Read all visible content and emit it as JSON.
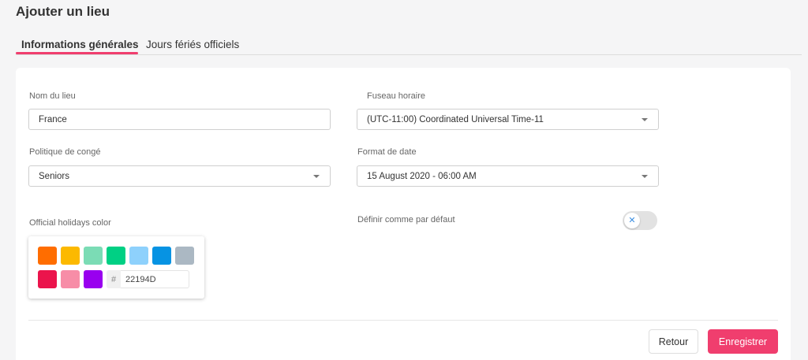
{
  "page": {
    "title": "Ajouter un lieu"
  },
  "tabs": [
    {
      "label": "Informations générales",
      "active": true
    },
    {
      "label": "Jours fériés officiels",
      "active": false
    }
  ],
  "form": {
    "location_name": {
      "label": "Nom du lieu",
      "value": "France"
    },
    "timezone": {
      "label": "Fuseau horaire",
      "value": "(UTC-11:00) Coordinated Universal Time-11"
    },
    "leave_policy": {
      "label": "Politique de congé",
      "value": "Seniors"
    },
    "date_format": {
      "label": "Format de date",
      "value": "15 August 2020 - 06:00 AM"
    },
    "holiday_color": {
      "label": "Official holidays color",
      "swatches": [
        "#ff6d00",
        "#fcb900",
        "#7bdcb5",
        "#00d084",
        "#8ed1fc",
        "#0693e3",
        "#abb8c3",
        "#eb144c",
        "#f78da7",
        "#9900ef"
      ],
      "hash": "#",
      "hex_value": "22194D"
    },
    "default": {
      "label": "Définir comme par défaut",
      "enabled": false,
      "knob_symbol": "✕"
    }
  },
  "actions": {
    "back_label": "Retour",
    "save_label": "Enregistrer"
  },
  "colors": {
    "accent": "#f03e6e",
    "toggle_icon": "#3a8de0"
  }
}
